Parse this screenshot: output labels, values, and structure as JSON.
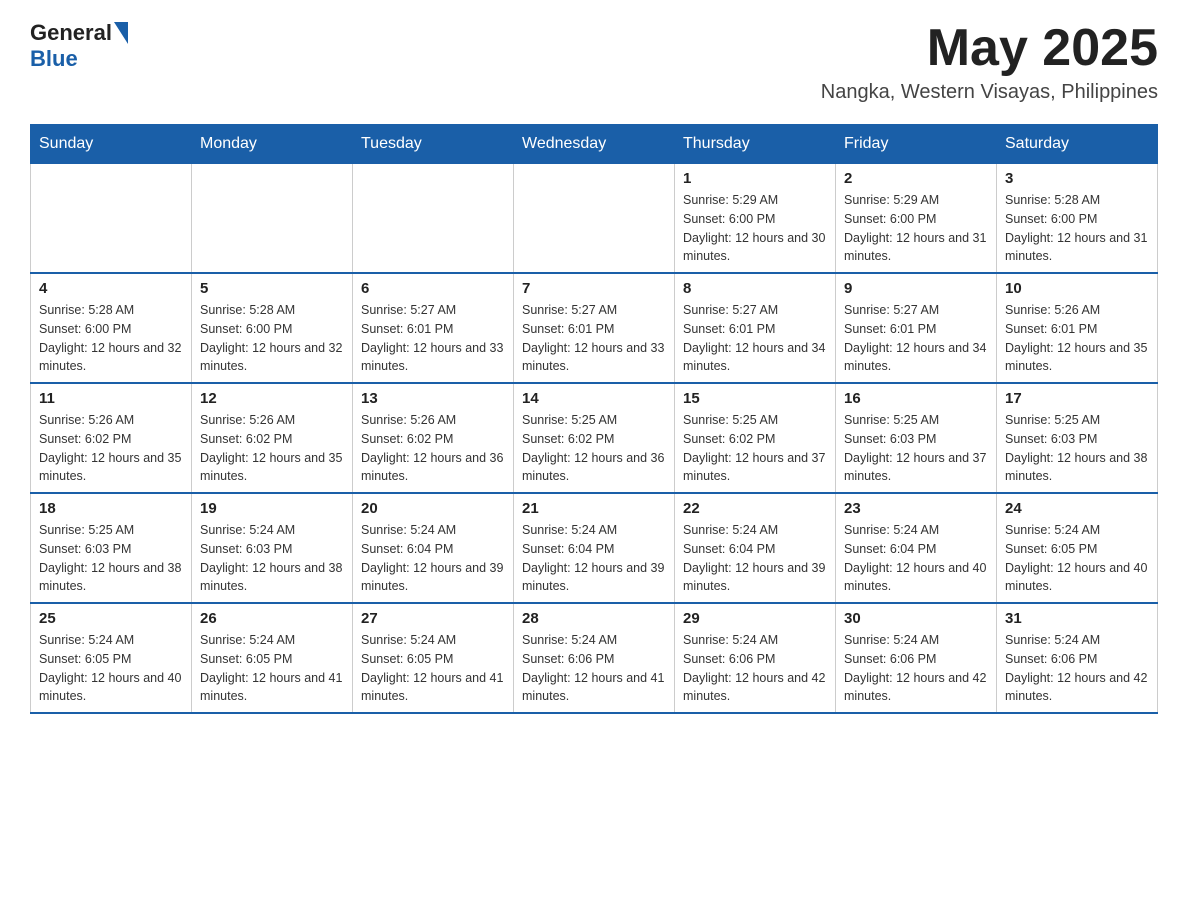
{
  "header": {
    "logo": {
      "general": "General",
      "blue": "Blue"
    },
    "title": "May 2025",
    "location": "Nangka, Western Visayas, Philippines"
  },
  "calendar": {
    "days_of_week": [
      "Sunday",
      "Monday",
      "Tuesday",
      "Wednesday",
      "Thursday",
      "Friday",
      "Saturday"
    ],
    "weeks": [
      [
        {
          "day": "",
          "info": ""
        },
        {
          "day": "",
          "info": ""
        },
        {
          "day": "",
          "info": ""
        },
        {
          "day": "",
          "info": ""
        },
        {
          "day": "1",
          "info": "Sunrise: 5:29 AM\nSunset: 6:00 PM\nDaylight: 12 hours and 30 minutes."
        },
        {
          "day": "2",
          "info": "Sunrise: 5:29 AM\nSunset: 6:00 PM\nDaylight: 12 hours and 31 minutes."
        },
        {
          "day": "3",
          "info": "Sunrise: 5:28 AM\nSunset: 6:00 PM\nDaylight: 12 hours and 31 minutes."
        }
      ],
      [
        {
          "day": "4",
          "info": "Sunrise: 5:28 AM\nSunset: 6:00 PM\nDaylight: 12 hours and 32 minutes."
        },
        {
          "day": "5",
          "info": "Sunrise: 5:28 AM\nSunset: 6:00 PM\nDaylight: 12 hours and 32 minutes."
        },
        {
          "day": "6",
          "info": "Sunrise: 5:27 AM\nSunset: 6:01 PM\nDaylight: 12 hours and 33 minutes."
        },
        {
          "day": "7",
          "info": "Sunrise: 5:27 AM\nSunset: 6:01 PM\nDaylight: 12 hours and 33 minutes."
        },
        {
          "day": "8",
          "info": "Sunrise: 5:27 AM\nSunset: 6:01 PM\nDaylight: 12 hours and 34 minutes."
        },
        {
          "day": "9",
          "info": "Sunrise: 5:27 AM\nSunset: 6:01 PM\nDaylight: 12 hours and 34 minutes."
        },
        {
          "day": "10",
          "info": "Sunrise: 5:26 AM\nSunset: 6:01 PM\nDaylight: 12 hours and 35 minutes."
        }
      ],
      [
        {
          "day": "11",
          "info": "Sunrise: 5:26 AM\nSunset: 6:02 PM\nDaylight: 12 hours and 35 minutes."
        },
        {
          "day": "12",
          "info": "Sunrise: 5:26 AM\nSunset: 6:02 PM\nDaylight: 12 hours and 35 minutes."
        },
        {
          "day": "13",
          "info": "Sunrise: 5:26 AM\nSunset: 6:02 PM\nDaylight: 12 hours and 36 minutes."
        },
        {
          "day": "14",
          "info": "Sunrise: 5:25 AM\nSunset: 6:02 PM\nDaylight: 12 hours and 36 minutes."
        },
        {
          "day": "15",
          "info": "Sunrise: 5:25 AM\nSunset: 6:02 PM\nDaylight: 12 hours and 37 minutes."
        },
        {
          "day": "16",
          "info": "Sunrise: 5:25 AM\nSunset: 6:03 PM\nDaylight: 12 hours and 37 minutes."
        },
        {
          "day": "17",
          "info": "Sunrise: 5:25 AM\nSunset: 6:03 PM\nDaylight: 12 hours and 38 minutes."
        }
      ],
      [
        {
          "day": "18",
          "info": "Sunrise: 5:25 AM\nSunset: 6:03 PM\nDaylight: 12 hours and 38 minutes."
        },
        {
          "day": "19",
          "info": "Sunrise: 5:24 AM\nSunset: 6:03 PM\nDaylight: 12 hours and 38 minutes."
        },
        {
          "day": "20",
          "info": "Sunrise: 5:24 AM\nSunset: 6:04 PM\nDaylight: 12 hours and 39 minutes."
        },
        {
          "day": "21",
          "info": "Sunrise: 5:24 AM\nSunset: 6:04 PM\nDaylight: 12 hours and 39 minutes."
        },
        {
          "day": "22",
          "info": "Sunrise: 5:24 AM\nSunset: 6:04 PM\nDaylight: 12 hours and 39 minutes."
        },
        {
          "day": "23",
          "info": "Sunrise: 5:24 AM\nSunset: 6:04 PM\nDaylight: 12 hours and 40 minutes."
        },
        {
          "day": "24",
          "info": "Sunrise: 5:24 AM\nSunset: 6:05 PM\nDaylight: 12 hours and 40 minutes."
        }
      ],
      [
        {
          "day": "25",
          "info": "Sunrise: 5:24 AM\nSunset: 6:05 PM\nDaylight: 12 hours and 40 minutes."
        },
        {
          "day": "26",
          "info": "Sunrise: 5:24 AM\nSunset: 6:05 PM\nDaylight: 12 hours and 41 minutes."
        },
        {
          "day": "27",
          "info": "Sunrise: 5:24 AM\nSunset: 6:05 PM\nDaylight: 12 hours and 41 minutes."
        },
        {
          "day": "28",
          "info": "Sunrise: 5:24 AM\nSunset: 6:06 PM\nDaylight: 12 hours and 41 minutes."
        },
        {
          "day": "29",
          "info": "Sunrise: 5:24 AM\nSunset: 6:06 PM\nDaylight: 12 hours and 42 minutes."
        },
        {
          "day": "30",
          "info": "Sunrise: 5:24 AM\nSunset: 6:06 PM\nDaylight: 12 hours and 42 minutes."
        },
        {
          "day": "31",
          "info": "Sunrise: 5:24 AM\nSunset: 6:06 PM\nDaylight: 12 hours and 42 minutes."
        }
      ]
    ]
  }
}
